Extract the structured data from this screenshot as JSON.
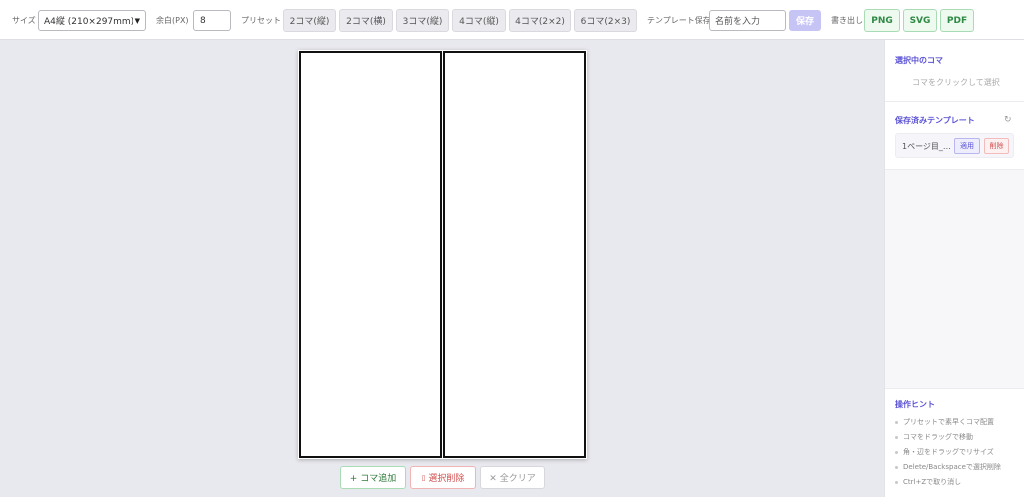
{
  "toolbar": {
    "size_label": "サイズ",
    "size_value": "A4縦 (210×297mm)",
    "margin_label": "余白(PX)",
    "margin_value": "8",
    "preset_label": "プリセット",
    "presets": [
      "2コマ(縦)",
      "2コマ(横)",
      "3コマ(縦)",
      "4コマ(縦)",
      "4コマ(2×2)",
      "6コマ(2×3)"
    ],
    "template_save_label": "テンプレート保存",
    "name_placeholder": "名前を入力",
    "save_label": "保存",
    "export_label": "書き出し",
    "exports": [
      "PNG",
      "SVG",
      "PDF"
    ]
  },
  "canvas": {
    "panel_count": 2
  },
  "actions": {
    "add": "+ コマ追加",
    "delete": "選択削除",
    "clear": "✕ 全クリア"
  },
  "sidebar": {
    "selected_title": "選択中のコマ",
    "selected_empty": "コマをクリックして選択",
    "templates_title": "保存済みテンプレート",
    "templates": [
      {
        "name": "1ページ目_…",
        "apply": "適用",
        "remove": "削除"
      }
    ],
    "hints_title": "操作ヒント",
    "hints": [
      "プリセットで素早くコマ配置",
      "コマをドラッグで移動",
      "角・辺をドラッグでリサイズ",
      "Delete/Backspaceで選択削除",
      "Ctrl+Zで取り消し"
    ]
  },
  "icons": {
    "dropdown": "chevron-down-icon",
    "refresh": "refresh-icon",
    "delete": "trash-icon"
  }
}
